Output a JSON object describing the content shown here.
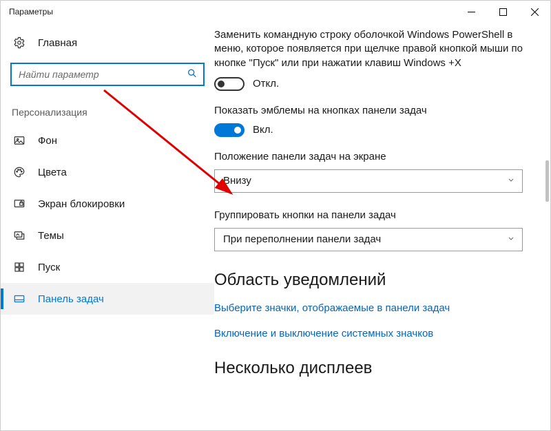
{
  "window": {
    "title": "Параметры"
  },
  "sidebar": {
    "home": "Главная",
    "search_placeholder": "Найти параметр",
    "section": "Персонализация",
    "items": [
      {
        "label": "Фон"
      },
      {
        "label": "Цвета"
      },
      {
        "label": "Экран блокировки"
      },
      {
        "label": "Темы"
      },
      {
        "label": "Пуск"
      },
      {
        "label": "Панель задач"
      }
    ]
  },
  "content": {
    "powershell_desc": "Заменить командную строку оболочкой Windows PowerShell в меню, которое появляется при щелчке правой кнопкой мыши по кнопке \"Пуск\" или при нажатии клавиш Windows +X",
    "toggle_off": "Откл.",
    "badges_label": "Показать эмблемы на кнопках панели задач",
    "toggle_on": "Вкл.",
    "position_label": "Положение панели задач на экране",
    "position_value": "Внизу",
    "group_label": "Группировать кнопки на панели задач",
    "group_value": "При переполнении панели задач",
    "area_heading": "Область уведомлений",
    "link_icons": "Выберите значки, отображаемые в панели задач",
    "link_system": "Включение и выключение системных значков",
    "displays_heading": "Несколько дисплеев"
  }
}
